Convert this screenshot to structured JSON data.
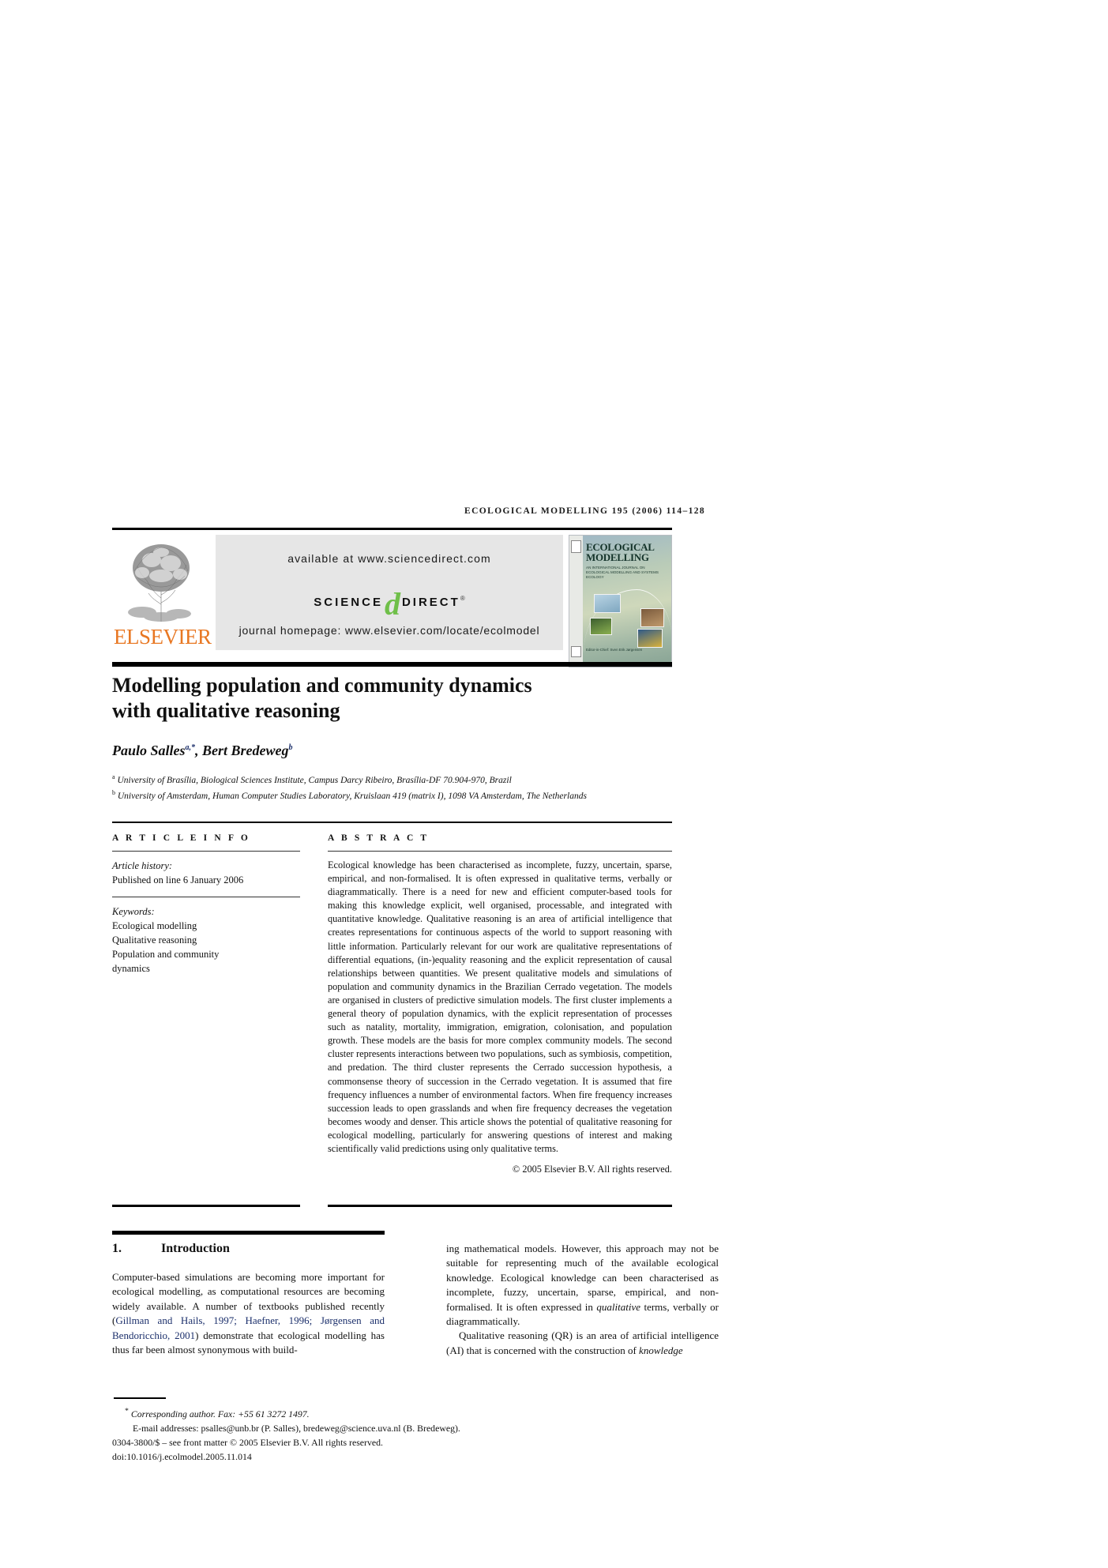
{
  "header": {
    "running_head": "ECOLOGICAL MODELLING 195 (2006) 114–128"
  },
  "banner": {
    "publisher_name": "ELSEVIER",
    "available_at": "available at www.sciencedirect.com",
    "sciencedirect_science": "SCIENCE",
    "sciencedirect_d": "d",
    "sciencedirect_direct": "DIRECT",
    "sciencedirect_reg": "®",
    "journal_homepage": "journal homepage: www.elsevier.com/locate/ecolmodel",
    "cover": {
      "title": "ECOLOGICAL MODELLING",
      "subtitle": "AN INTERNATIONAL JOURNAL ON ECOLOGICAL MODELLING AND SYSTEMS ECOLOGY",
      "footer": "Editor-in-Chief: Sven Erik Jørgensen"
    }
  },
  "article": {
    "title_line1": "Modelling population and community dynamics",
    "title_line2": "with qualitative reasoning",
    "authors_html": "Paulo Salles",
    "author1": "Paulo Salles",
    "author1_sup": "a,*",
    "author_sep": ", ",
    "author2": "Bert Bredeweg",
    "author2_sup": "b",
    "affiliation_a_sup": "a",
    "affiliation_a": " University of Brasília, Biological Sciences Institute, Campus Darcy Ribeiro, Brasília-DF 70.904-970, Brazil",
    "affiliation_b_sup": "b",
    "affiliation_b": " University of Amsterdam, Human Computer Studies Laboratory, Kruislaan 419 (matrix I), 1098 VA Amsterdam, The Netherlands"
  },
  "article_info": {
    "label": "A R T I C L E   I N F O",
    "history_label": "Article history:",
    "history_value": "Published on line 6 January 2006",
    "keywords_label": "Keywords:",
    "keywords": [
      "Ecological modelling",
      "Qualitative reasoning",
      "Population and community",
      "dynamics"
    ]
  },
  "abstract": {
    "label": "A B S T R A C T",
    "text": "Ecological knowledge has been characterised as incomplete, fuzzy, uncertain, sparse, empirical, and non-formalised. It is often expressed in qualitative terms, verbally or diagrammatically. There is a need for new and efficient computer-based tools for making this knowledge explicit, well organised, processable, and integrated with quantitative knowledge. Qualitative reasoning is an area of artificial intelligence that creates representations for continuous aspects of the world to support reasoning with little information. Particularly relevant for our work are qualitative representations of differential equations, (in-)equality reasoning and the explicit representation of causal relationships between quantities. We present qualitative models and simulations of population and community dynamics in the Brazilian Cerrado vegetation. The models are organised in clusters of predictive simulation models. The first cluster implements a general theory of population dynamics, with the explicit representation of processes such as natality, mortality, immigration, emigration, colonisation, and population growth. These models are the basis for more complex community models. The second cluster represents interactions between two populations, such as symbiosis, competition, and predation. The third cluster represents the Cerrado succession hypothesis, a commonsense theory of succession in the Cerrado vegetation. It is assumed that fire frequency influences a number of environmental factors. When fire frequency increases succession leads to open grasslands and when fire frequency decreases the vegetation becomes woody and denser. This article shows the potential of qualitative reasoning for ecological modelling, particularly for answering questions of interest and making scientifically valid predictions using only qualitative terms.",
    "copyright": "© 2005 Elsevier B.V. All rights reserved."
  },
  "body": {
    "section_number": "1.",
    "section_title": "Introduction",
    "left_p1_part1": "Computer-based simulations are becoming more important for ecological modelling, as computational resources are becoming widely available. A number of textbooks published recently (",
    "left_p1_cite": "Gillman and Hails, 1997; Haefner, 1996; Jørgensen and Bendoricchio, 2001",
    "left_p1_part2": ") demonstrate that ecological modelling has thus far been almost synonymous with build-",
    "right_p1": "ing mathematical models. However, this approach may not be suitable for representing much of the available ecological knowledge. Ecological knowledge can been characterised as incomplete, fuzzy, uncertain, sparse, empirical, and non-formalised. It is often expressed in ",
    "right_p1_italic": "qualitative",
    "right_p1_cont": " terms, verbally or diagrammatically.",
    "right_p2_part1": "Qualitative reasoning (QR) is an area of artificial intelligence (AI) that is concerned with the construction of ",
    "right_p2_italic": "knowledge"
  },
  "footnotes": {
    "corresponding_sup": "*",
    "corresponding": " Corresponding author. Fax: +55 61 3272 1497.",
    "email_label": "E-mail addresses:",
    "email_value": " psalles@unb.br (P. Salles), bredeweg@science.uva.nl (B. Bredeweg).",
    "issn_line": "0304-3800/$ – see front matter © 2005 Elsevier B.V. All rights reserved.",
    "doi_line": "doi:10.1016/j.ecolmodel.2005.11.014"
  },
  "colors": {
    "elsevier_orange": "#E87722",
    "sciencedirect_green": "#6FBF49",
    "citation_blue": "#1b2f6b",
    "banner_grey": "#e6e6e6"
  }
}
